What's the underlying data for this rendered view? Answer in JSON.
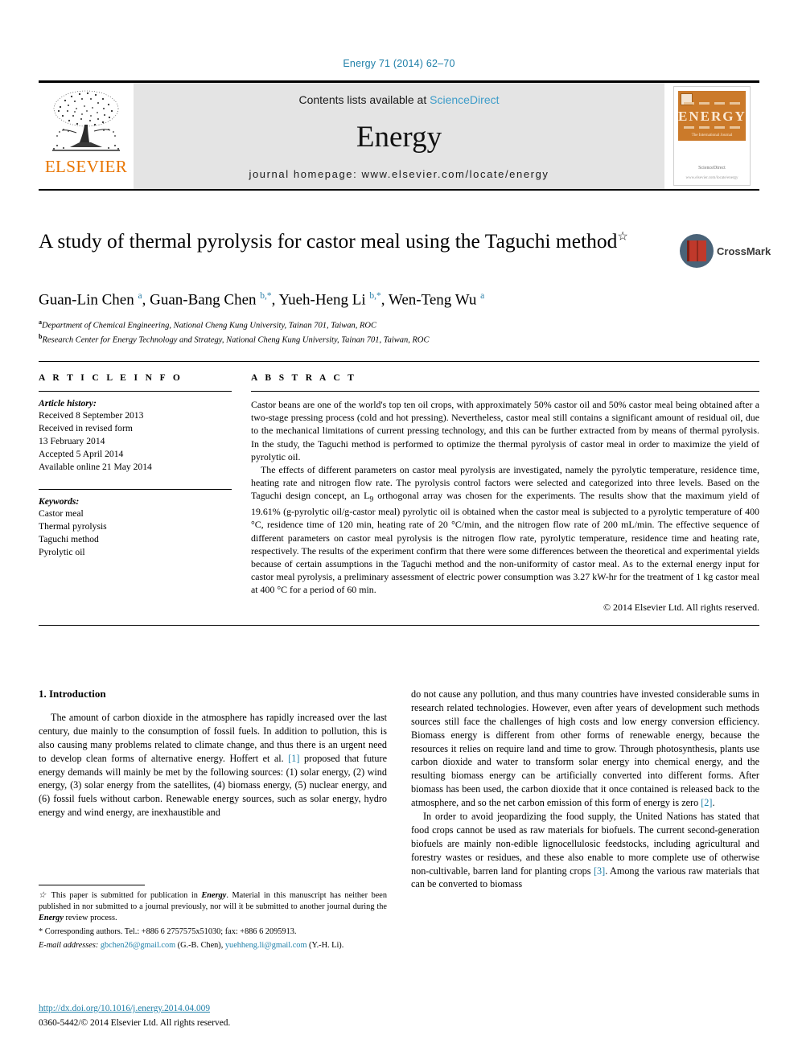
{
  "running_head": "Energy 71 (2014) 62–70",
  "banner": {
    "publisher": "ELSEVIER",
    "contents_prefix": "Contents lists available at ",
    "contents_link": "ScienceDirect",
    "journal_name": "Energy",
    "homepage": "journal homepage: www.elsevier.com/locate/energy",
    "cover": {
      "title": "ENERGY",
      "subtitle": "The International Journal",
      "publisher_small": "ScienceDirect",
      "url_small": "www.elsevier.com/locate/energy"
    }
  },
  "article": {
    "title": "A study of thermal pyrolysis for castor meal using the Taguchi method",
    "title_marker": "☆",
    "crossmark_label": "CrossMark",
    "authors_html": "Guan-Lin Chen <sup>a</sup>, Guan-Bang Chen <sup>b,</sup><sup>*</sup>, Yueh-Heng Li <sup>b,</sup><sup>*</sup>, Wen-Teng Wu <sup>a</sup>",
    "affiliations": [
      "Department of Chemical Engineering, National Cheng Kung University, Tainan 701, Taiwan, ROC",
      "Research Center for Energy Technology and Strategy, National Cheng Kung University, Tainan 701, Taiwan, ROC"
    ],
    "affiliation_marks": [
      "a",
      "b"
    ]
  },
  "info": {
    "heading": "A R T I C L E  I N F O",
    "history_label": "Article history:",
    "history": [
      "Received 8 September 2013",
      "Received in revised form",
      "13 February 2014",
      "Accepted 5 April 2014",
      "Available online 21 May 2014"
    ],
    "keywords_label": "Keywords:",
    "keywords": [
      "Castor meal",
      "Thermal pyrolysis",
      "Taguchi method",
      "Pyrolytic oil"
    ]
  },
  "abstract": {
    "heading": "A B S T R A C T",
    "paragraph1": "Castor beans are one of the world's top ten oil crops, with approximately 50% castor oil and 50% castor meal being obtained after a two-stage pressing process (cold and hot pressing). Nevertheless, castor meal still contains a significant amount of residual oil, due to the mechanical limitations of current pressing technology, and this can be further extracted from by means of thermal pyrolysis. In the study, the Taguchi method is performed to optimize the thermal pyrolysis of castor meal in order to maximize the yield of pyrolytic oil.",
    "paragraph2_html": "The effects of different parameters on castor meal pyrolysis are investigated, namely the pyrolytic temperature, residence time, heating rate and nitrogen flow rate. The pyrolysis control factors were selected and categorized into three levels. Based on the Taguchi design concept, an L<sub>9</sub> orthogonal array was chosen for the experiments. The results show that the maximum yield of 19.61% (g-pyrolytic oil/g-castor meal) pyrolytic oil is obtained when the castor meal is subjected to a pyrolytic temperature of 400 &#176;C, residence time of 120 min, heating rate of 20 &#176;C/min, and the nitrogen flow rate of 200 mL/min. The effective sequence of different parameters on castor meal pyrolysis is the nitrogen flow rate, pyrolytic temperature, residence time and heating rate, respectively. The results of the experiment confirm that there were some differences between the theoretical and experimental yields because of certain assumptions in the Taguchi method and the non-uniformity of castor meal. As to the external energy input for castor meal pyrolysis, a preliminary assessment of electric power consumption was 3.27 kW-hr for the treatment of 1 kg castor meal at 400 &#176;C for a period of 60 min.",
    "copyright": "© 2014 Elsevier Ltd. All rights reserved."
  },
  "introduction": {
    "heading": "1. Introduction",
    "left_paragraph_html": "The amount of carbon dioxide in the atmosphere has rapidly increased over the last century, due mainly to the consumption of fossil fuels. In addition to pollution, this is also causing many problems related to climate change, and thus there is an urgent need to develop clean forms of alternative energy. Hoffert et al. <span class=\"ref\">[1]</span> proposed that future energy demands will mainly be met by the following sources: (1) solar energy, (2) wind energy, (3) solar energy from the satellites, (4) biomass energy, (5) nuclear energy, and (6) fossil fuels without carbon. Renewable energy sources, such as solar energy, hydro energy and wind energy, are inexhaustible and",
    "right_paragraph1_html": "do not cause any pollution, and thus many countries have invested considerable sums in research related technologies. However, even after years of development such methods sources still face the challenges of high costs and low energy conversion efficiency. Biomass energy is different from other forms of renewable energy, because the resources it relies on require land and time to grow. Through photosynthesis, plants use carbon dioxide and water to transform solar energy into chemical energy, and the resulting biomass energy can be artificially converted into different forms. After biomass has been used, the carbon dioxide that it once contained is released back to the atmosphere, and so the net carbon emission of this form of energy is zero <span class=\"ref\">[2]</span>.",
    "right_paragraph2_html": "In order to avoid jeopardizing the food supply, the United Nations has stated that food crops cannot be used as raw materials for biofuels. The current second-generation biofuels are mainly non-edible lignocellulosic feedstocks, including agricultural and forestry wastes or residues, and these also enable to more complete use of otherwise non-cultivable, barren land for planting crops <span class=\"ref\">[3]</span>. Among the various raw materials that can be converted to biomass"
  },
  "footnotes": {
    "star_html": "<span class=\"it\">☆</span> This paper is submitted for publication in <span class=\"bld\">Energy</span>. Material in this manuscript has neither been published in nor submitted to a journal previously, nor will it be submitted to another journal during the <span class=\"bld\">Energy</span> review process.",
    "corresponding_html": "* Corresponding authors. Tel.: +886 6 2757575x51030; fax: +886 6 2095913.",
    "email_html": "<span class=\"it\">E-mail addresses:</span> <span class=\"ref\">gbchen26@gmail.com</span> (G.-B. Chen), <span class=\"ref\">yuehheng.li@gmail.com</span> (Y.-H. Li)."
  },
  "doi": {
    "url": "http://dx.doi.org/10.1016/j.energy.2014.04.009",
    "issn_line": "0360-5442/© 2014 Elsevier Ltd. All rights reserved."
  }
}
